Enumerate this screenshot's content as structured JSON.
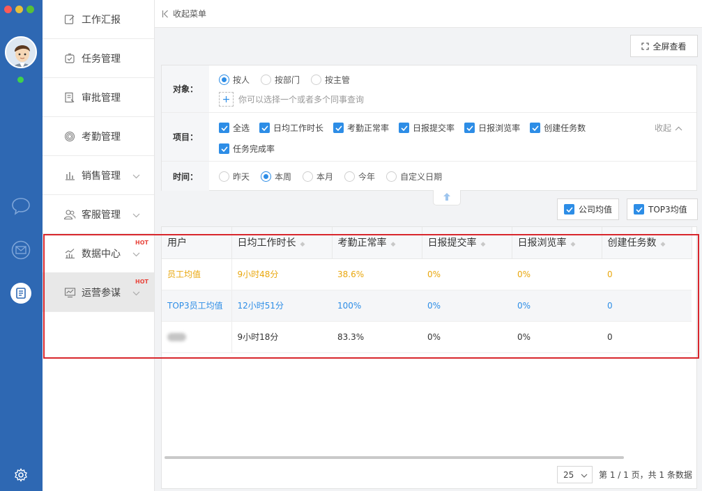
{
  "window": {
    "traffic_lights": [
      "close",
      "minimize",
      "maximize"
    ]
  },
  "rail": {
    "icons": [
      "avatar",
      "chat-icon",
      "mail-icon",
      "document-icon",
      "settings-icon"
    ],
    "online_color": "#3fd14b",
    "bg_color": "#2e68b3"
  },
  "menu": {
    "items": [
      {
        "label": "工作汇报",
        "icon": "edit-icon",
        "chevron": false,
        "hot": false
      },
      {
        "label": "任务管理",
        "icon": "task-check-icon",
        "chevron": false,
        "hot": false
      },
      {
        "label": "审批管理",
        "icon": "approval-doc-icon",
        "chevron": false,
        "hot": false
      },
      {
        "label": "考勤管理",
        "icon": "fingerprint-icon",
        "chevron": false,
        "hot": false
      },
      {
        "label": "销售管理",
        "icon": "bar-chart-icon",
        "chevron": true,
        "hot": false
      },
      {
        "label": "客服管理",
        "icon": "users-icon",
        "chevron": true,
        "hot": false
      },
      {
        "label": "数据中心",
        "icon": "trend-chart-icon",
        "chevron": true,
        "hot": true,
        "hot_label": "HOT"
      },
      {
        "label": "运营参谋",
        "icon": "monitor-chart-icon",
        "chevron": true,
        "hot": true,
        "hot_label": "HOT",
        "active": true
      }
    ]
  },
  "topbar": {
    "collapse_label": "收起菜单"
  },
  "fullscreen_label": "全屏查看",
  "filter": {
    "target": {
      "label": "对象：",
      "options": [
        "按人",
        "按部门",
        "按主管"
      ],
      "selected": "按人",
      "placeholder": "你可以选择一个或者多个同事查询"
    },
    "items": {
      "label": "项目：",
      "options": [
        "全选",
        "日均工作时长",
        "考勤正常率",
        "日报提交率",
        "日报浏览率",
        "创建任务数",
        "任务完成率"
      ],
      "collapse_label": "收起"
    },
    "time": {
      "label": "时间：",
      "options": [
        "昨天",
        "本周",
        "本月",
        "今年",
        "自定义日期"
      ],
      "selected": "本周"
    }
  },
  "buttons": {
    "company_avg": "公司均值",
    "top3_avg": "TOP3均值"
  },
  "table": {
    "headers": [
      "用户",
      "日均工作时长",
      "考勤正常率",
      "日报提交率",
      "日报浏览率",
      "创建任务数"
    ],
    "rows": [
      {
        "type": "avg",
        "cells": [
          "员工均值",
          "9小时48分",
          "38.6%",
          "0%",
          "0%",
          "0"
        ]
      },
      {
        "type": "top3",
        "cells": [
          "TOP3员工均值",
          "12小时51分",
          "100%",
          "0%",
          "0%",
          "0"
        ]
      },
      {
        "type": "user",
        "cells": [
          "",
          "9小时18分",
          "83.3%",
          "0%",
          "0%",
          "0"
        ]
      }
    ]
  },
  "pager": {
    "page_size": "25",
    "summary": "第 1 / 1 页，共 1 条数据"
  },
  "colors": {
    "accent": "#2d8de6",
    "avg_text": "#e9a70d",
    "hot": "#e8453c",
    "highlight_frame": "#d8262c"
  }
}
